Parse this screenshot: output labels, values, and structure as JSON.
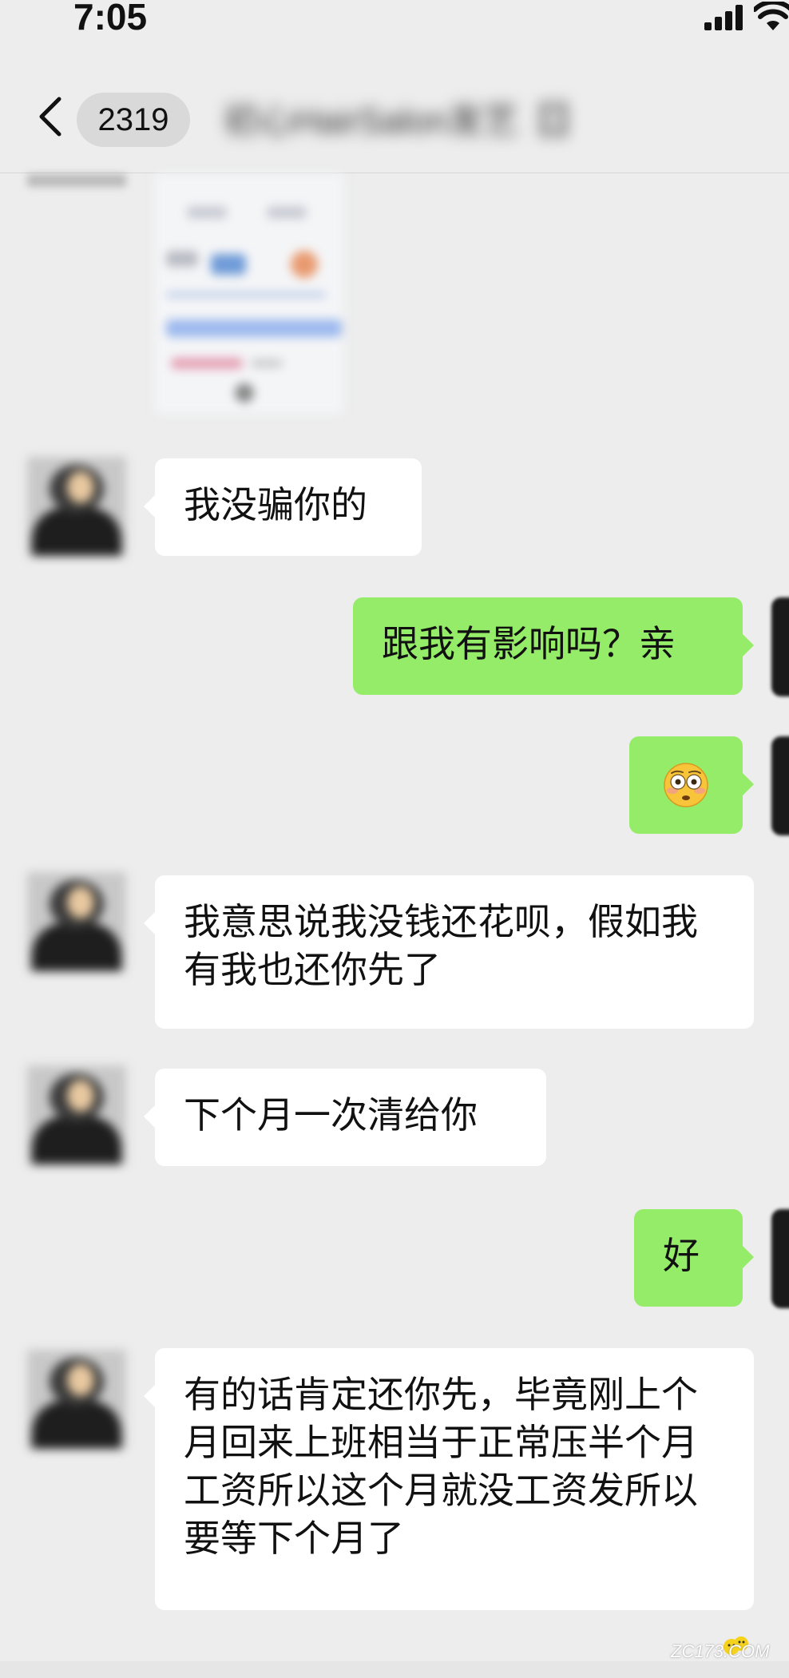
{
  "status_bar": {
    "time": "7:05"
  },
  "nav_bar": {
    "unread_count": "2319",
    "title": "初心HairSalon发艺【】"
  },
  "messages": [
    {
      "side": "left",
      "type": "image"
    },
    {
      "side": "left",
      "type": "text",
      "text": "我没骗你的"
    },
    {
      "side": "right",
      "type": "text",
      "text": "跟我有影响吗？亲"
    },
    {
      "side": "right",
      "type": "emoji",
      "emoji": "flushed-face"
    },
    {
      "side": "left",
      "type": "text",
      "text": "我意思说我没钱还花呗，假如我有我也还你先了"
    },
    {
      "side": "left",
      "type": "text",
      "text": "下个月一次清给你"
    },
    {
      "side": "right",
      "type": "text",
      "text": "好"
    },
    {
      "side": "left",
      "type": "text",
      "text": "有的话肯定还你先，毕竟刚上个月回来上班相当于正常压半个月工资所以这个月就没工资发所以要等下个月了"
    }
  ],
  "watermark": {
    "text": "ZC173.COM"
  },
  "colors": {
    "background": "#ededed",
    "incoming_bubble": "#ffffff",
    "outgoing_bubble": "#95ec69"
  }
}
